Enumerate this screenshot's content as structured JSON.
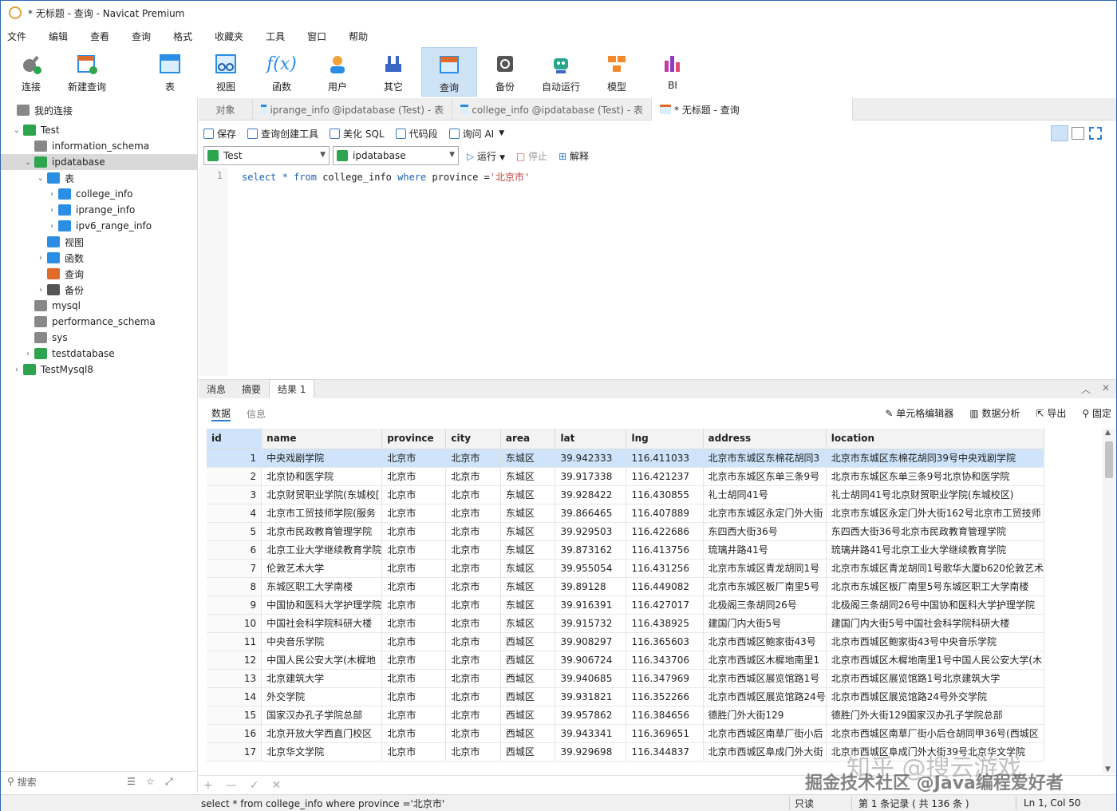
{
  "app": {
    "title": "* 无标题 - 查询 - Navicat Premium"
  },
  "menu": [
    "文件",
    "编辑",
    "查看",
    "查询",
    "格式",
    "收藏夹",
    "工具",
    "窗口",
    "帮助"
  ],
  "toolbar": [
    {
      "label": "连接",
      "icon": "plug-icon",
      "color": "#6c6c6c"
    },
    {
      "label": "新建查询",
      "icon": "new-query-icon",
      "color": "#e06a2c"
    },
    {
      "label": "表",
      "icon": "table-icon",
      "color": "#2a8ee5"
    },
    {
      "label": "视图",
      "icon": "view-icon",
      "color": "#2a8ee5"
    },
    {
      "label": "函数",
      "icon": "function-icon",
      "color": "#2a8ee5"
    },
    {
      "label": "用户",
      "icon": "user-icon",
      "color": "#f3a13a"
    },
    {
      "label": "其它",
      "icon": "tools-icon",
      "color": "#3a66c4"
    },
    {
      "label": "查询",
      "icon": "query-icon",
      "color": "#e06a2c"
    },
    {
      "label": "备份",
      "icon": "backup-icon",
      "color": "#555"
    },
    {
      "label": "自动运行",
      "icon": "robot-icon",
      "color": "#2aa58e"
    },
    {
      "label": "模型",
      "icon": "model-icon",
      "color": "#f08a2a"
    },
    {
      "label": "BI",
      "icon": "bi-icon",
      "color": "#c23aa8"
    }
  ],
  "sidebar": {
    "header": "我的连接",
    "items": [
      {
        "label": "Test",
        "icon": "connection-icon",
        "color": "#2da44e"
      },
      {
        "label": "information_schema",
        "icon": "database-icon",
        "color": "#888"
      },
      {
        "label": "ipdatabase",
        "icon": "database-icon",
        "color": "#2da44e"
      },
      {
        "label": "表",
        "icon": "table-icon",
        "color": "#2a8ee5"
      },
      {
        "label": "college_info",
        "icon": "table-icon",
        "color": "#2a8ee5"
      },
      {
        "label": "iprange_info",
        "icon": "table-icon",
        "color": "#2a8ee5"
      },
      {
        "label": "ipv6_range_info",
        "icon": "table-icon",
        "color": "#2a8ee5"
      },
      {
        "label": "视图",
        "icon": "view-icon",
        "color": "#2a8ee5"
      },
      {
        "label": "函数",
        "icon": "function-icon",
        "color": "#2a8ee5"
      },
      {
        "label": "查询",
        "icon": "query-icon",
        "color": "#e06a2c"
      },
      {
        "label": "备份",
        "icon": "backup-icon",
        "color": "#555"
      },
      {
        "label": "mysql",
        "icon": "database-icon",
        "color": "#888"
      },
      {
        "label": "performance_schema",
        "icon": "database-icon",
        "color": "#888"
      },
      {
        "label": "sys",
        "icon": "database-icon",
        "color": "#888"
      },
      {
        "label": "testdatabase",
        "icon": "database-icon",
        "color": "#2da44e"
      },
      {
        "label": "TestMysql8",
        "icon": "connection-icon",
        "color": "#2da44e"
      }
    ],
    "search_placeholder": "搜索"
  },
  "tabs": [
    "对象",
    "iprange_info @ipdatabase (Test) - 表",
    "college_info @ipdatabase (Test) - 表",
    "* 无标题 - 查询"
  ],
  "query_toolbar": [
    "保存",
    "查询创建工具",
    "美化 SQL",
    "代码段",
    "询问 AI"
  ],
  "selectors": {
    "connection": "Test",
    "database": "ipdatabase"
  },
  "run": {
    "run": "运行",
    "stop": "停止",
    "explain": "解释"
  },
  "editor": {
    "line": "1",
    "kw1": "select",
    "star": "*",
    "kw2": "from",
    "table": "college_info",
    "kw3": "where",
    "col": "province",
    "op": "=",
    "val": "'北京市'"
  },
  "result_tabs": [
    "消息",
    "摘要",
    "结果 1"
  ],
  "sub_tabs": [
    "数据",
    "信息"
  ],
  "result_tools": [
    "单元格编辑器",
    "数据分析",
    "导出",
    "固定"
  ],
  "table": {
    "columns": [
      "id",
      "name",
      "province",
      "city",
      "area",
      "lat",
      "lng",
      "address",
      "location"
    ],
    "rows": [
      [
        "1",
        "中央戏剧学院",
        "北京市",
        "北京市",
        "东城区",
        "39.942333",
        "116.411033",
        "北京市东城区东棉花胡同3",
        "北京市东城区东棉花胡同39号中央戏剧学院"
      ],
      [
        "2",
        "北京协和医学院",
        "北京市",
        "北京市",
        "东城区",
        "39.917338",
        "116.421237",
        "北京市东城区东单三条9号",
        "北京市东城区东单三条9号北京协和医学院"
      ],
      [
        "3",
        "北京财贸职业学院(东城校[",
        "北京市",
        "北京市",
        "东城区",
        "39.928422",
        "116.430855",
        "礼士胡同41号",
        "礼士胡同41号北京财贸职业学院(东城校区)"
      ],
      [
        "4",
        "北京市工贸技师学院(服务",
        "北京市",
        "北京市",
        "东城区",
        "39.866465",
        "116.407889",
        "北京市东城区永定门外大街",
        "北京市东城区永定门外大街162号北京市工贸技师"
      ],
      [
        "5",
        "北京市民政教育管理学院",
        "北京市",
        "北京市",
        "东城区",
        "39.929503",
        "116.422686",
        "东四西大街36号",
        "东四西大街36号北京市民政教育管理学院"
      ],
      [
        "6",
        "北京工业大学继续教育学院",
        "北京市",
        "北京市",
        "东城区",
        "39.873162",
        "116.413756",
        "琉璃井路41号",
        "琉璃井路41号北京工业大学继续教育学院"
      ],
      [
        "7",
        "伦敦艺术大学",
        "北京市",
        "北京市",
        "东城区",
        "39.955054",
        "116.431256",
        "北京市东城区青龙胡同1号",
        "北京市东城区青龙胡同1号歌华大厦b620伦敦艺术"
      ],
      [
        "8",
        "东城区职工大学南楼",
        "北京市",
        "北京市",
        "东城区",
        "39.89128",
        "116.449082",
        "北京市东城区板厂南里5号",
        "北京市东城区板厂南里5号东城区职工大学南楼"
      ],
      [
        "9",
        "中国协和医科大学护理学院",
        "北京市",
        "北京市",
        "东城区",
        "39.916391",
        "116.427017",
        "北极阁三条胡同26号",
        "北极阁三条胡同26号中国协和医科大学护理学院"
      ],
      [
        "10",
        "中国社会科学院科研大楼",
        "北京市",
        "北京市",
        "东城区",
        "39.915732",
        "116.438925",
        "建国门内大街5号",
        "建国门内大街5号中国社会科学院科研大楼"
      ],
      [
        "11",
        "中央音乐学院",
        "北京市",
        "北京市",
        "西城区",
        "39.908297",
        "116.365603",
        "北京市西城区鲍家街43号",
        "北京市西城区鲍家街43号中央音乐学院"
      ],
      [
        "12",
        "中国人民公安大学(木樨地",
        "北京市",
        "北京市",
        "西城区",
        "39.906724",
        "116.343706",
        "北京市西城区木樨地南里1",
        "北京市西城区木樨地南里1号中国人民公安大学(木"
      ],
      [
        "13",
        "北京建筑大学",
        "北京市",
        "北京市",
        "西城区",
        "39.940685",
        "116.347969",
        "北京市西城区展览馆路1号",
        "北京市西城区展览馆路1号北京建筑大学"
      ],
      [
        "14",
        "外交学院",
        "北京市",
        "北京市",
        "西城区",
        "39.931821",
        "116.352266",
        "北京市西城区展览馆路24号",
        "北京市西城区展览馆路24号外交学院"
      ],
      [
        "15",
        "国家汉办孔子学院总部",
        "北京市",
        "北京市",
        "西城区",
        "39.957862",
        "116.384656",
        "德胜门外大街129",
        "德胜门外大街129国家汉办孔子学院总部"
      ],
      [
        "16",
        "北京开放大学西直门校区",
        "北京市",
        "北京市",
        "西城区",
        "39.943341",
        "116.369651",
        "北京市西城区南草厂街小后",
        "北京市西城区南草厂街小后仓胡同甲36号(西城区"
      ],
      [
        "17",
        "北京华文学院",
        "北京市",
        "北京市",
        "西城区",
        "39.929698",
        "116.344837",
        "北京市西城区阜成门外大街",
        "北京市西城区阜成门外大街39号北京华文学院"
      ]
    ]
  },
  "grid_footer": [
    "+",
    "—",
    "✓",
    "✕"
  ],
  "status": {
    "sql": "select * from college_info where province ='北京市'",
    "mode": "只读",
    "records": "第 1 条记录 ( 共 136 条 )",
    "cursor": "Ln 1, Col 50"
  },
  "watermark": {
    "line1": "知乎 @搜云游戏",
    "line2": "掘金技术社区 @Java编程爱好者"
  }
}
